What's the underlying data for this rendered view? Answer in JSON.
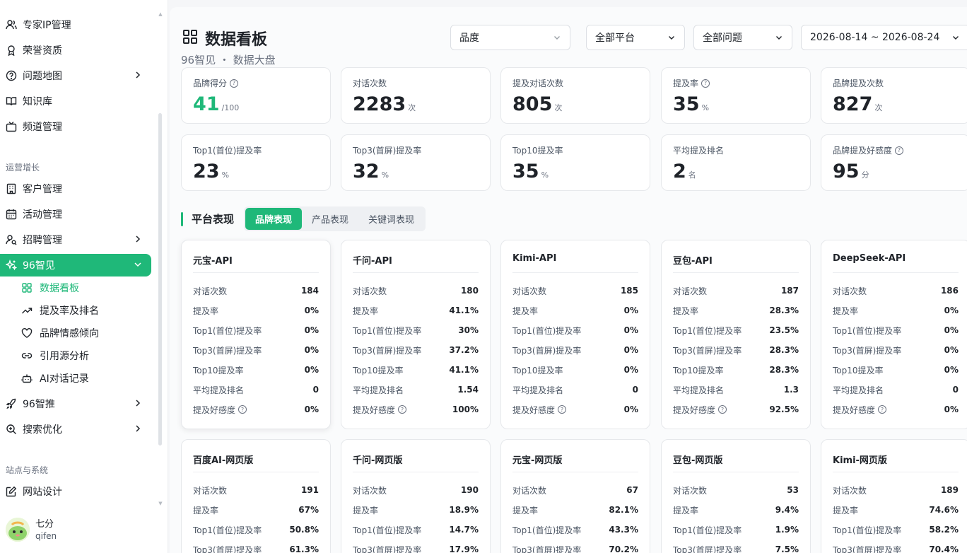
{
  "sidebar": {
    "items_top": [
      {
        "label": "专家IP管理",
        "icon": "user-icon"
      },
      {
        "label": "荣誉资质",
        "icon": "award-icon"
      },
      {
        "label": "问题地图",
        "icon": "question-icon",
        "chevron": true
      },
      {
        "label": "知识库",
        "icon": "book-icon"
      },
      {
        "label": "频道管理",
        "icon": "tv-icon"
      }
    ],
    "group_ops": "运营增长",
    "items_ops": [
      {
        "label": "客户管理",
        "icon": "building-icon"
      },
      {
        "label": "活动管理",
        "icon": "calendar-icon"
      },
      {
        "label": "招聘管理",
        "icon": "user-search-icon",
        "chevron": true
      },
      {
        "label": "96智见",
        "icon": "sparkle-icon",
        "chevron": true
      }
    ],
    "sub_items": [
      {
        "label": "数据看板",
        "icon": "grid-icon"
      },
      {
        "label": "提及率及排名",
        "icon": "trend-icon"
      },
      {
        "label": "品牌情感倾向",
        "icon": "heart-icon"
      },
      {
        "label": "引用源分析",
        "icon": "link-icon"
      },
      {
        "label": "AI对话记录",
        "icon": "bot-icon"
      }
    ],
    "items_more": [
      {
        "label": "96智推",
        "icon": "rocket-icon",
        "chevron": true
      },
      {
        "label": "搜索优化",
        "icon": "search-icon",
        "chevron": true
      }
    ],
    "group_site": "站点与系统",
    "items_site": [
      {
        "label": "网站设计",
        "icon": "edit-icon"
      }
    ],
    "user": {
      "name": "七分",
      "id": "qifen"
    }
  },
  "header": {
    "title": "数据看板",
    "crumb": "96智见 ・ 数据大盘",
    "filters": [
      "品度",
      "全部平台",
      "全部问题",
      "2026-08-14 ~ 2026-08-24"
    ]
  },
  "stats": [
    {
      "label": "品牌得分",
      "value": "41",
      "unit": "/100",
      "help": true,
      "green": true
    },
    {
      "label": "对话次数",
      "value": "2283",
      "unit": "次"
    },
    {
      "label": "提及对话次数",
      "value": "805",
      "unit": "次"
    },
    {
      "label": "提及率",
      "value": "35",
      "unit": "%",
      "help": true
    },
    {
      "label": "品牌提及次数",
      "value": "827",
      "unit": "次"
    },
    {
      "label": "Top1(首位)提及率",
      "value": "23",
      "unit": "%"
    },
    {
      "label": "Top3(首屏)提及率",
      "value": "32",
      "unit": "%"
    },
    {
      "label": "Top10提及率",
      "value": "35",
      "unit": "%"
    },
    {
      "label": "平均提及排名",
      "value": "2",
      "unit": "名"
    },
    {
      "label": "品牌提及好感度",
      "value": "95",
      "unit": "分",
      "help": true
    }
  ],
  "section": {
    "title": "平台表现",
    "tabs": [
      "品牌表现",
      "产品表现",
      "关键词表现"
    ]
  },
  "row_labels": [
    "对话次数",
    "提及率",
    "Top1(首位)提及率",
    "Top3(首屏)提及率",
    "Top10提及率",
    "平均提及排名",
    "提及好感度"
  ],
  "platforms": [
    {
      "name": "元宝-API",
      "values": [
        "184",
        "0%",
        "0%",
        "0%",
        "0%",
        "0",
        "0%"
      ]
    },
    {
      "name": "千问-API",
      "values": [
        "180",
        "41.1%",
        "30%",
        "37.2%",
        "41.1%",
        "1.54",
        "100%"
      ]
    },
    {
      "name": "Kimi-API",
      "values": [
        "185",
        "0%",
        "0%",
        "0%",
        "0%",
        "0",
        "0%"
      ]
    },
    {
      "name": "豆包-API",
      "values": [
        "187",
        "28.3%",
        "23.5%",
        "28.3%",
        "28.3%",
        "1.3",
        "92.5%"
      ]
    },
    {
      "name": "DeepSeek-API",
      "values": [
        "186",
        "0%",
        "0%",
        "0%",
        "0%",
        "0",
        "0%"
      ]
    },
    {
      "name": "百度AI-网页版",
      "values": [
        "191",
        "67%",
        "50.8%",
        "61.3%"
      ]
    },
    {
      "name": "千问-网页版",
      "values": [
        "190",
        "18.9%",
        "14.7%",
        "17.9%"
      ]
    },
    {
      "name": "元宝-网页版",
      "values": [
        "67",
        "82.1%",
        "43.3%",
        "70.2%"
      ]
    },
    {
      "name": "豆包-网页版",
      "values": [
        "53",
        "9.4%",
        "1.9%",
        "7.5%"
      ]
    },
    {
      "name": "Kimi-网页版",
      "values": [
        "189",
        "74.6%",
        "58.2%",
        "70.4%"
      ]
    }
  ],
  "colors": {
    "accent": "#1fb879"
  }
}
